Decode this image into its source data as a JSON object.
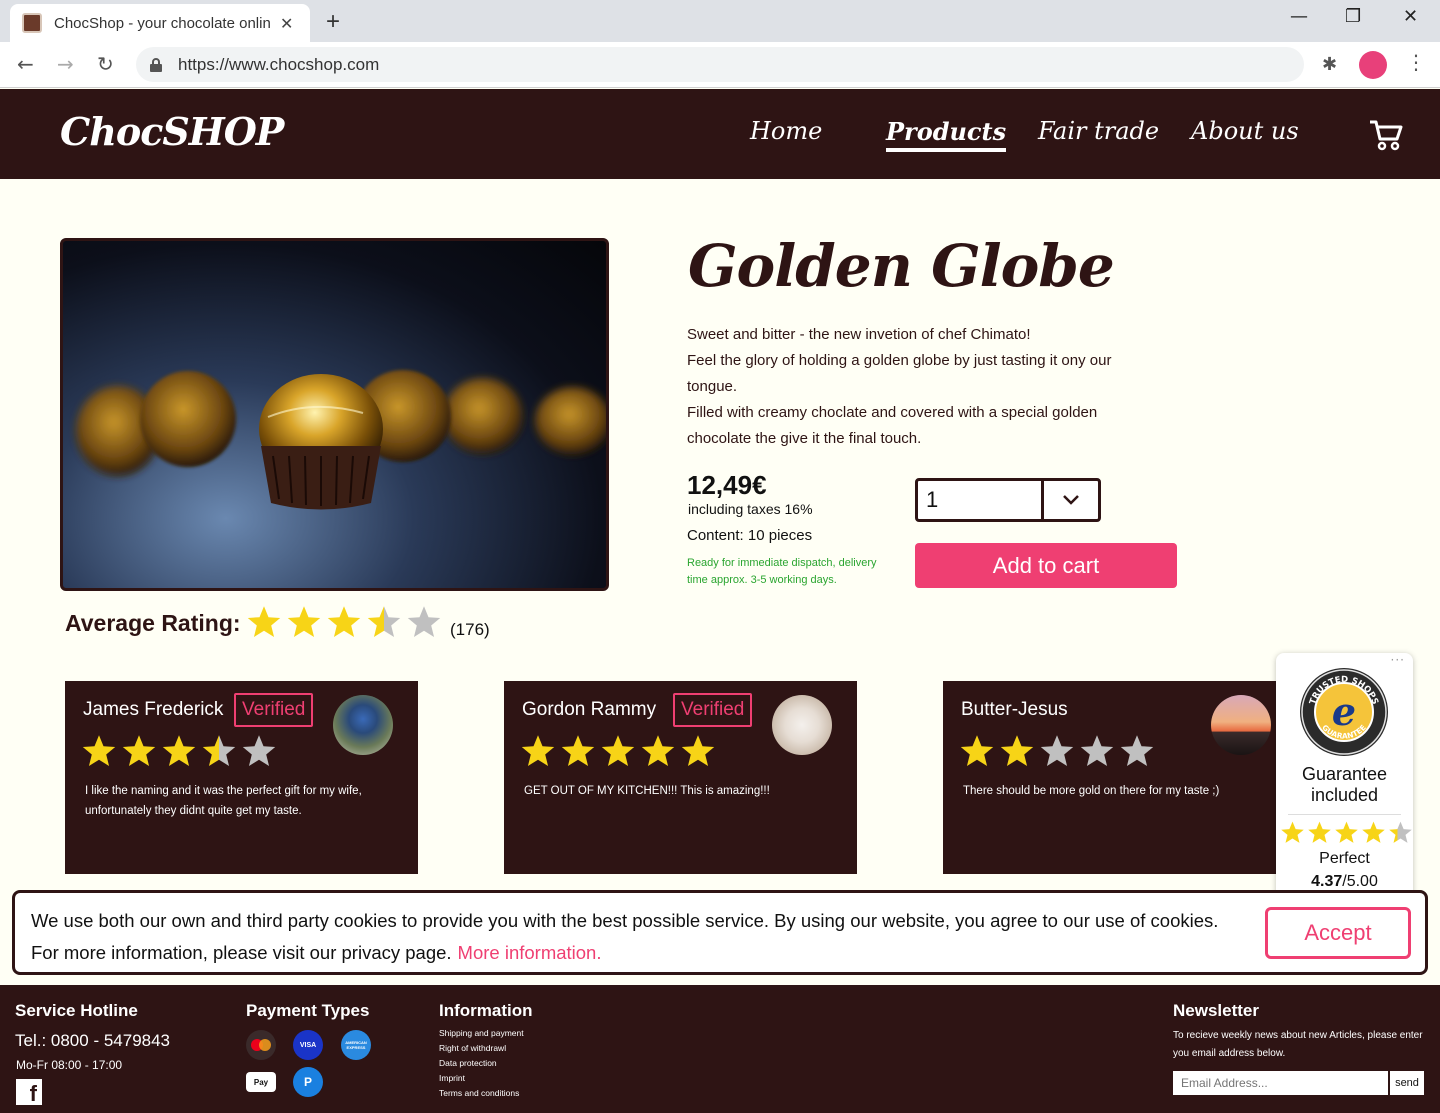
{
  "browser": {
    "tab_title": "ChocShop - your chocolate onlin",
    "url": "https://www.chocshop.com"
  },
  "header": {
    "logo": "ChocSHOP",
    "nav": [
      "Home",
      "Products",
      "Fair trade",
      "About us"
    ],
    "active_nav": "Products"
  },
  "product": {
    "title": "Golden Globe",
    "description": [
      "Sweet and bitter - the new invetion of chef Chimato!",
      "Feel the glory of holding a golden globe by just tasting it ony our tongue.",
      "Filled with creamy choclate and covered with a special golden chocolate the give it the final touch."
    ],
    "price": "12,49€",
    "tax_note": "including taxes 16%",
    "content": "Content: 10 pieces",
    "dispatch": "Ready for immediate dispatch, delivery time approx. 3-5 working days.",
    "quantity": "1",
    "add_to_cart": "Add to cart"
  },
  "rating": {
    "label": "Average Rating:",
    "value": 3.5,
    "max": 5,
    "count": "(176)"
  },
  "reviews": [
    {
      "name": "James Frederick",
      "verified": "Verified",
      "stars": 3.5,
      "text": "I like the naming and it was the perfect gift for my wife, unfortunately they didnt quite get my taste."
    },
    {
      "name": "Gordon Rammy",
      "verified": "Verified",
      "stars": 5,
      "text": "GET OUT OF MY KITCHEN!!! This is amazing!!!"
    },
    {
      "name": "Butter-Jesus",
      "verified": "",
      "stars": 2,
      "text": "There should be more gold on there for my taste ;)"
    }
  ],
  "trusted_shops": {
    "seal_text": "TRUSTED SHOPS GUARANTEE",
    "guarantee": "Guarantee included",
    "stars": 4.37,
    "label": "Perfect",
    "score": "4.37",
    "score_max": "/5.00"
  },
  "cookie": {
    "text": "We use both our own and third party cookies to provide you with the best possible service. By using our website, you agree to our use of cookies. For more information, please visit our privacy page.",
    "link": "More information.",
    "accept": "Accept"
  },
  "footer": {
    "hotline_title": "Service Hotline",
    "phone": "Tel.: 0800 - 5479843",
    "hours": "Mo-Fr 08:00 - 17:00",
    "payment_title": "Payment Types",
    "payments": [
      "mastercard-icon",
      "visa-icon",
      "amex-icon",
      "applepay-icon",
      "paypal-icon"
    ],
    "payment_labels": {
      "visa": "VISA",
      "amex": "AMERICAN EXPRESS",
      "applepay": "Pay",
      "paypal": "P"
    },
    "info_title": "Information",
    "info_links": [
      "Shipping and payment",
      "Right of withdrawl",
      "Data protection",
      "Imprint",
      "Terms and conditions"
    ],
    "newsletter_title": "Newsletter",
    "newsletter_text": "To recieve weekly news about new Articles, please enter you email address below.",
    "email_placeholder": "Email Address...",
    "send": "send"
  },
  "colors": {
    "brand_dark": "#2e1414",
    "accent_pink": "#ef3f72",
    "star_yellow": "#f7d417",
    "star_grey": "#c0c0c0",
    "page_bg": "#fffff5"
  }
}
